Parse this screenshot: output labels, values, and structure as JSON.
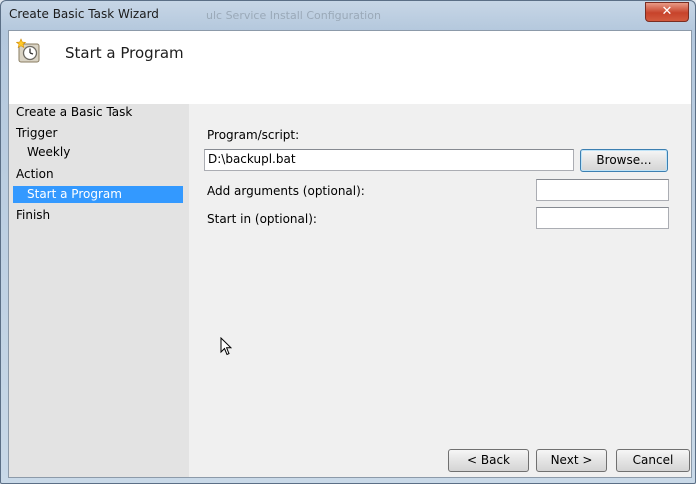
{
  "window": {
    "title": "Create Basic Task Wizard",
    "background_title": "ulc Service Install Configuration",
    "close_glyph": "✕"
  },
  "header": {
    "icon": "task-clock-icon",
    "title": "Start a Program"
  },
  "sidebar": {
    "items": [
      {
        "label": "Create a Basic Task"
      },
      {
        "label": "Trigger"
      },
      {
        "label": "Weekly"
      },
      {
        "label": "Action"
      },
      {
        "label": "Start a Program"
      },
      {
        "label": "Finish"
      }
    ],
    "selected_color": "#3399ff"
  },
  "form": {
    "program_label": "Program/script:",
    "program_value": "D:\\backupl.bat",
    "browse_label": "Browse...",
    "arguments_label": "Add arguments (optional):",
    "arguments_value": "",
    "startin_label": "Start in (optional):",
    "startin_value": ""
  },
  "footer": {
    "back_label": "< Back",
    "next_label": "Next >",
    "cancel_label": "Cancel"
  }
}
